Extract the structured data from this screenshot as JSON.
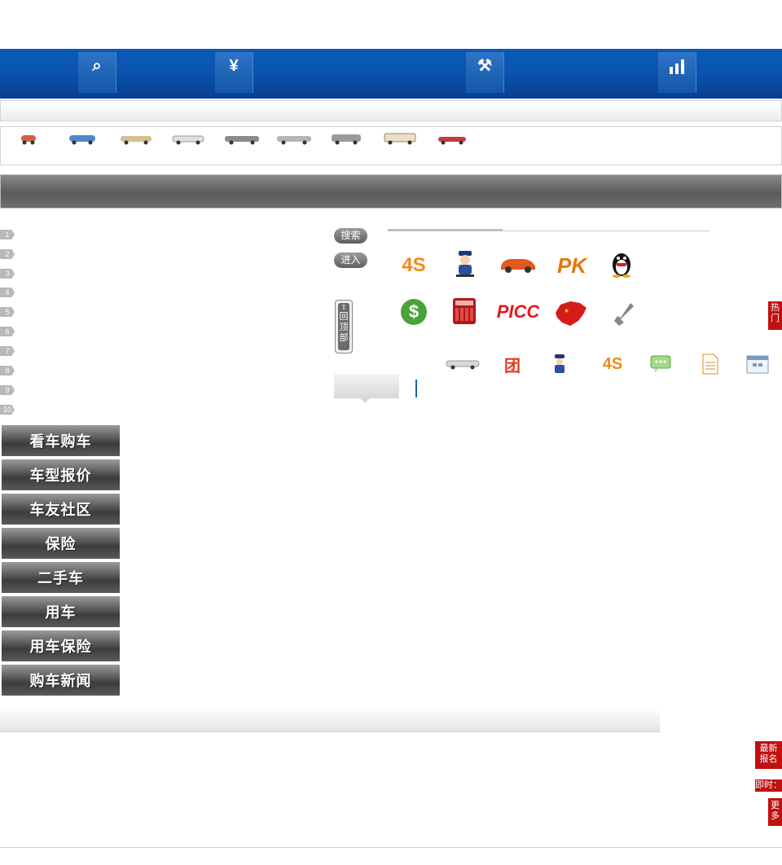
{
  "header": {
    "nav_icons": [
      "search-icon",
      "yuan-icon",
      "tools-icon",
      "bar-chart-icon"
    ],
    "nav_glyphs": [
      "⌕",
      "¥",
      "⚒",
      "▮"
    ]
  },
  "car_strip": {
    "items": [
      "mini-car-icon",
      "hatchback-car-icon",
      "sedan-car-icon",
      "sedan-car-icon",
      "sedan-car-icon",
      "sedan-car-icon",
      "suv-car-icon",
      "van-car-icon",
      "sports-car-icon"
    ]
  },
  "rank_list": [
    "1",
    "2",
    "3",
    "4",
    "5",
    "6",
    "7",
    "8",
    "9",
    "10"
  ],
  "buttons": {
    "search": "搜索",
    "enter": "进入"
  },
  "back_to_top": "回顶部",
  "service_icons_row1": [
    {
      "icon": "4s-store-icon",
      "text": "4S",
      "color": "#f08a1a"
    },
    {
      "icon": "police-icon",
      "text": "",
      "color": "#1b3b7a"
    },
    {
      "icon": "orange-car-icon",
      "text": "",
      "color": "#e25a1c"
    },
    {
      "icon": "pk-icon",
      "text": "PK",
      "color": "#e07a10"
    },
    {
      "icon": "qq-penguin-icon",
      "text": "",
      "color": "#111"
    }
  ],
  "service_icons_row2": [
    {
      "icon": "dollar-coin-icon",
      "text": "$",
      "color": "#4aa23a"
    },
    {
      "icon": "calculator-icon",
      "text": "",
      "color": "#b01818"
    },
    {
      "icon": "picc-logo-icon",
      "text": "PICC",
      "color": "#e21a1a"
    },
    {
      "icon": "china-map-icon",
      "text": "",
      "color": "#d61b1b"
    },
    {
      "icon": "wrench-icon",
      "text": "",
      "color": "#777"
    }
  ],
  "small_icons": [
    {
      "icon": "sedan-icon",
      "text": ""
    },
    {
      "icon": "group-buy-icon",
      "text": "团",
      "color": "#e03a1a"
    },
    {
      "icon": "police-small-icon",
      "text": ""
    },
    {
      "icon": "4s-small-icon",
      "text": "4S",
      "color": "#f08a1a"
    },
    {
      "icon": "chat-bubble-icon",
      "text": ""
    },
    {
      "icon": "document-icon",
      "text": ""
    },
    {
      "icon": "calendar-icon",
      "text": ""
    }
  ],
  "menu": [
    "看车购车",
    "车型报价",
    "车友社区",
    "保险",
    "二手车",
    "用车",
    "用车保险",
    "购车新闻"
  ],
  "side_tags": {
    "hot": "热门",
    "newest_signup": "最新 报名",
    "instant": "即时：",
    "more": "更多"
  }
}
